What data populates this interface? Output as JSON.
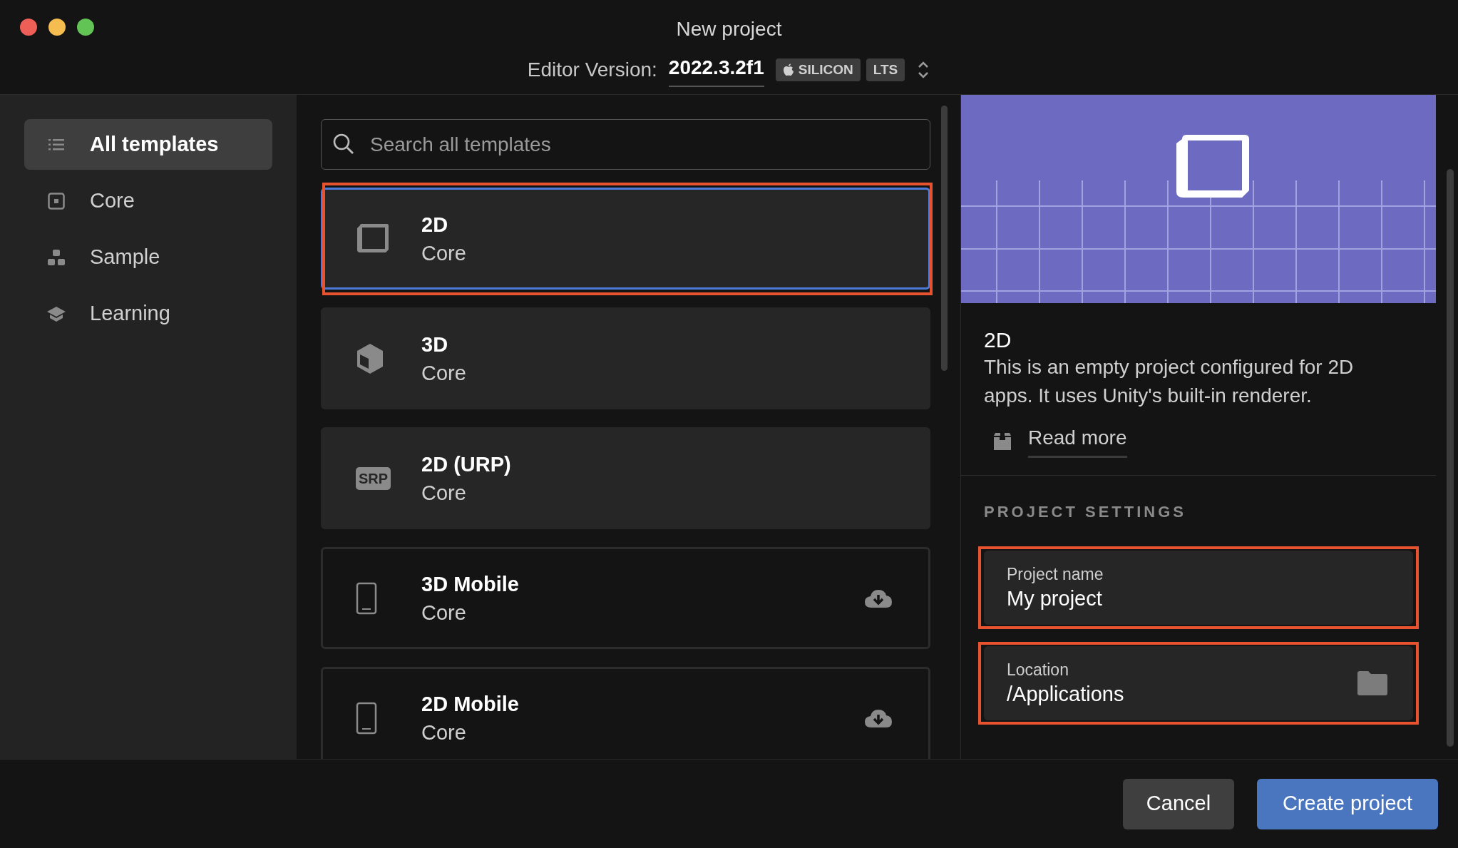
{
  "window": {
    "title": "New project",
    "traffic_lights": [
      {
        "color": "#ee5f57"
      },
      {
        "color": "#f5bd4f"
      },
      {
        "color": "#61c455"
      }
    ]
  },
  "editor_version": {
    "label": "Editor Version:",
    "value": "2022.3.2f1",
    "badges": [
      {
        "kind": "platform",
        "text": "SILICON"
      },
      {
        "kind": "plain",
        "text": "LTS"
      }
    ]
  },
  "sidebar": {
    "items": [
      {
        "label": "All templates",
        "kind": "list",
        "selected": true
      },
      {
        "label": "Core",
        "kind": "core",
        "selected": false
      },
      {
        "label": "Sample",
        "kind": "sample",
        "selected": false
      },
      {
        "label": "Learning",
        "kind": "learning",
        "selected": false
      }
    ]
  },
  "search": {
    "placeholder": "Search all templates"
  },
  "templates": [
    {
      "title": "2D",
      "subtitle": "Core",
      "kind": "square",
      "selected": true,
      "downloaded": true,
      "highlighted": true
    },
    {
      "title": "3D",
      "subtitle": "Core",
      "kind": "cube",
      "selected": false,
      "downloaded": true,
      "highlighted": false
    },
    {
      "title": "2D (URP)",
      "subtitle": "Core",
      "kind": "srp",
      "icon_text": "SRP",
      "selected": false,
      "downloaded": true,
      "highlighted": false
    },
    {
      "title": "3D Mobile",
      "subtitle": "Core",
      "kind": "phone",
      "selected": false,
      "downloaded": false,
      "highlighted": false
    },
    {
      "title": "2D Mobile",
      "subtitle": "Core",
      "kind": "phone",
      "selected": false,
      "downloaded": false,
      "highlighted": false
    }
  ],
  "details": {
    "title": "2D",
    "description": "This is an empty project configured for 2D apps. It uses Unity's built-in renderer.",
    "read_more": "Read more"
  },
  "project_settings": {
    "heading": "PROJECT SETTINGS",
    "fields": [
      {
        "kind": "text",
        "label": "Project name",
        "value": "My project",
        "highlighted": true
      },
      {
        "kind": "folder",
        "label": "Location",
        "value": "/Applications",
        "highlighted": true
      }
    ]
  },
  "buttons": [
    {
      "kind": "secondary",
      "label": "Cancel"
    },
    {
      "kind": "primary",
      "label": "Create project"
    }
  ]
}
